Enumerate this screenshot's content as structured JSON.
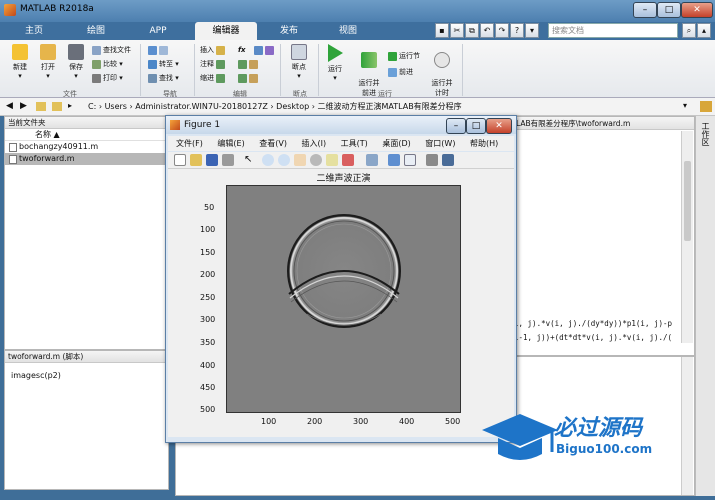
{
  "app": {
    "title": "MATLAB R2018a"
  },
  "tabs": [
    "主页",
    "绘图",
    "APP",
    "编辑器",
    "发布",
    "视图"
  ],
  "search": {
    "placeholder": "搜索文档"
  },
  "ribbon": {
    "file": {
      "new": "新建",
      "open": "打开",
      "save": "保存",
      "find_files": "查找文件",
      "compare": "比较",
      "print": "打印",
      "group": "文件"
    },
    "nav": {
      "goto": "转至",
      "find": "查找",
      "group": "导航"
    },
    "edit": {
      "insert": "插入",
      "comment": "注释",
      "indent": "缩进",
      "fx": "fx",
      "group": "编辑"
    },
    "breakpoints": {
      "label": "断点",
      "group": "断点"
    },
    "run": {
      "run": "运行",
      "run_advance": "运行并\n前进",
      "run_section": "运行节",
      "advance": "前进",
      "run_time": "运行并\n计时",
      "group": "运行"
    }
  },
  "address": {
    "path": "C: › Users › Administrator.WIN7U-20180127Z › Desktop › 二维波动方程正演MATLAB有限差分程序"
  },
  "current_folder": {
    "header": "当前文件夹",
    "column": "名称 ▲",
    "files": [
      "bochangzy40911.m",
      "twoforward.m"
    ]
  },
  "details": {
    "header": "twoforward.m (脚本)",
    "content": "imagesc(p2)"
  },
  "editor": {
    "header": "LAB有限差分程序\\twoforward.m",
    "line1": "i, j).*v(i, j)./(dy*dy))*p1(i, j)-p",
    "line2": "i-1, j))+(dt*dt*v(i, j).*v(i, j)./("
  },
  "workspace_side": "工作区",
  "figure": {
    "title": "Figure 1",
    "menu": [
      "文件(F)",
      "编辑(E)",
      "查看(V)",
      "插入(I)",
      "工具(T)",
      "桌面(D)",
      "窗口(W)",
      "帮助(H)"
    ],
    "plot_title": "二维声波正演",
    "yticks": [
      "50",
      "100",
      "150",
      "200",
      "250",
      "300",
      "350",
      "400",
      "450",
      "500"
    ],
    "xticks": [
      "100",
      "200",
      "300",
      "400",
      "500"
    ]
  },
  "watermark": {
    "main": "必过源码",
    "sub": "Biguo100.com"
  },
  "colors": {
    "titlebar": "#4d7faf",
    "tabbar": "#3e6f9e",
    "plot_bg": "#808080",
    "accent": "#1e74c8"
  }
}
